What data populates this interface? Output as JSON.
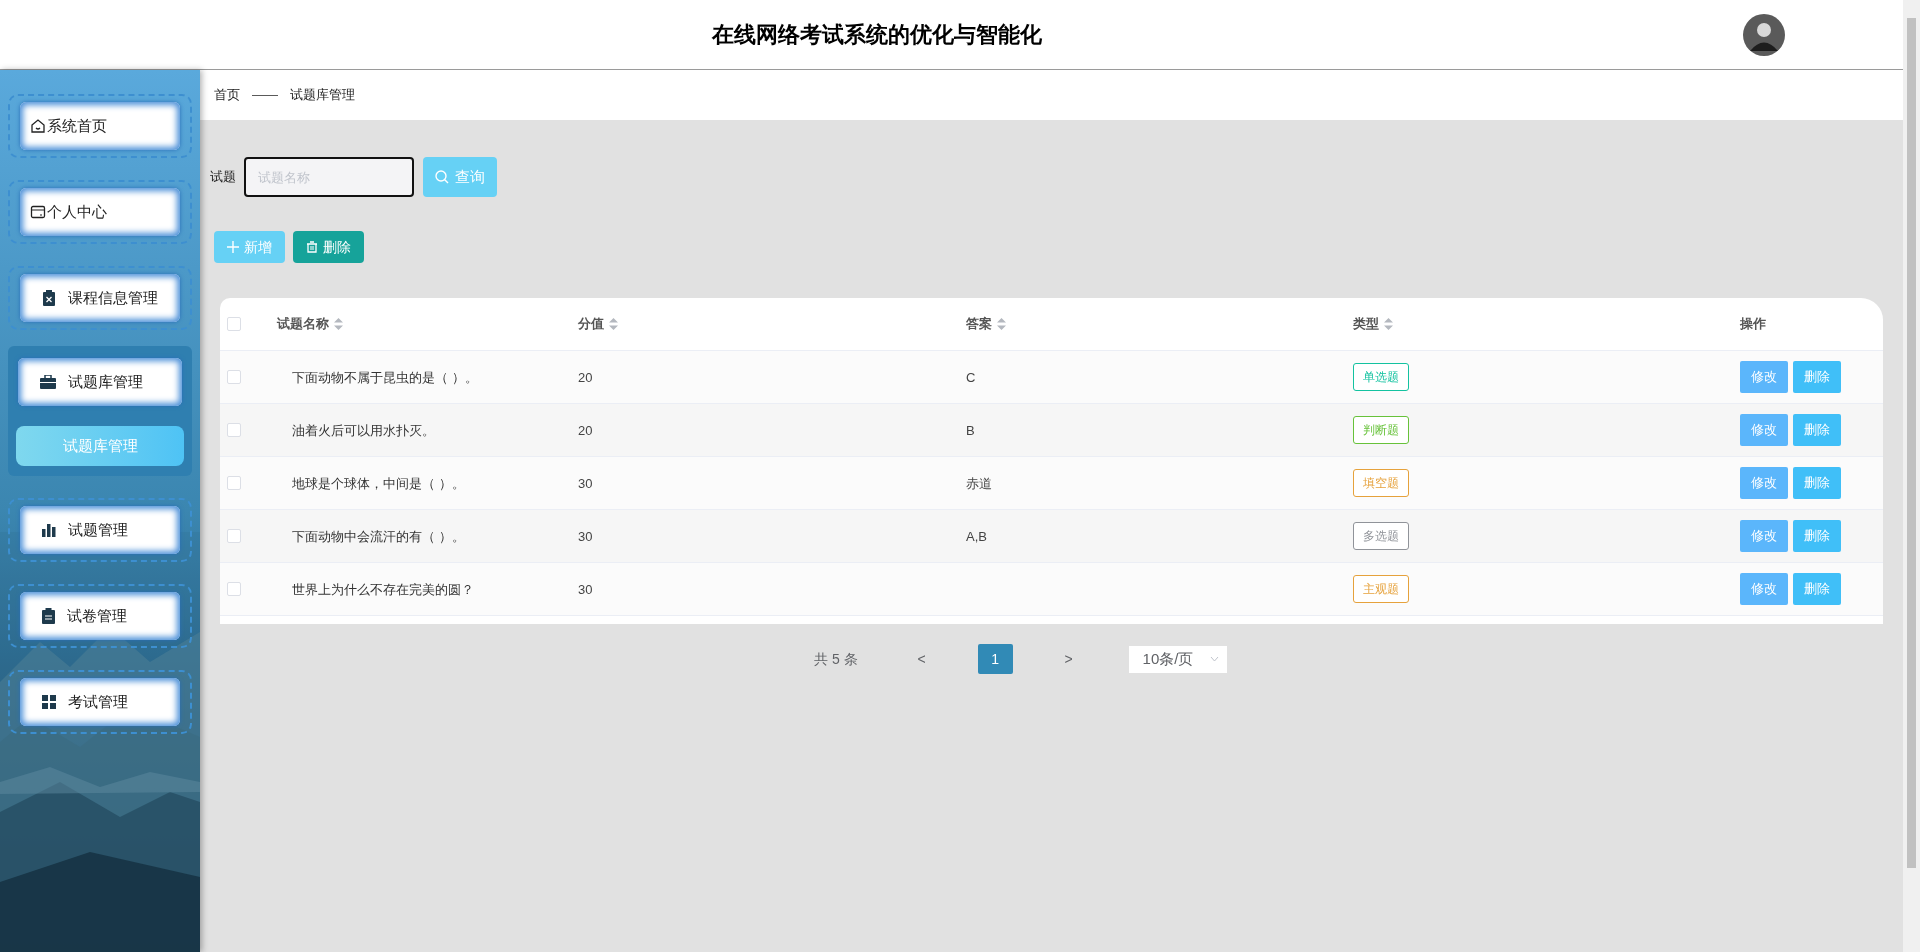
{
  "header": {
    "title": "在线网络考试系统的优化与智能化"
  },
  "sidebar": {
    "items": [
      {
        "label": "系统首页",
        "expanded": false
      },
      {
        "label": "个人中心",
        "expanded": false
      },
      {
        "label": "课程信息管理",
        "expanded": false
      },
      {
        "label": "试题库管理",
        "expanded": true,
        "children": [
          {
            "label": "试题库管理",
            "selected": true
          }
        ]
      },
      {
        "label": "试题管理",
        "expanded": false
      },
      {
        "label": "试卷管理",
        "expanded": false
      },
      {
        "label": "考试管理",
        "expanded": false
      }
    ]
  },
  "breadcrumb": [
    "首页",
    "——",
    "试题库管理"
  ],
  "search": {
    "label": "试题",
    "placeholder": "试题名称",
    "button": "查询"
  },
  "actions": [
    {
      "label": "新增",
      "kind": "add"
    },
    {
      "label": "删除",
      "kind": "delete"
    }
  ],
  "table": {
    "all_checked": false,
    "columns": [
      {
        "label": "试题名称",
        "sortable": true
      },
      {
        "label": "分值",
        "sortable": true
      },
      {
        "label": "答案",
        "sortable": true
      },
      {
        "label": "类型",
        "sortable": true
      },
      {
        "label": "操作",
        "sortable": false
      }
    ],
    "rows": [
      {
        "checked": false,
        "name": "下面动物不属于昆虫的是（ ）。",
        "score": "20",
        "answer": "C",
        "type": {
          "label": "单选题",
          "color": "#13c2a0"
        },
        "buttons": [
          "修改",
          "删除"
        ]
      },
      {
        "checked": false,
        "name": "油着火后可以用水扑灭。",
        "score": "20",
        "answer": "B",
        "type": {
          "label": "判断题",
          "color": "#67c23a"
        },
        "buttons": [
          "修改",
          "删除"
        ]
      },
      {
        "checked": false,
        "name": "地球是个球体，中间是（  ）。",
        "score": "30",
        "answer": "赤道",
        "type": {
          "label": "填空题",
          "color": "#e6a23c"
        },
        "buttons": [
          "修改",
          "删除"
        ]
      },
      {
        "checked": false,
        "name": "下面动物中会流汗的有（  ）。",
        "score": "30",
        "answer": "A,B",
        "type": {
          "label": "多选题",
          "color": "#909399"
        },
        "buttons": [
          "修改",
          "删除"
        ]
      },
      {
        "checked": false,
        "name": "世界上为什么不存在完美的圆？",
        "score": "30",
        "type": {
          "label": "主观题",
          "color": "#e6a23c"
        },
        "buttons": [
          "修改",
          "删除"
        ]
      }
    ]
  },
  "pagination": {
    "total": "共 5 条",
    "prev": "<",
    "pages": [
      {
        "label": "1",
        "selected": true
      }
    ],
    "next": ">",
    "page_size": "10条/页"
  }
}
